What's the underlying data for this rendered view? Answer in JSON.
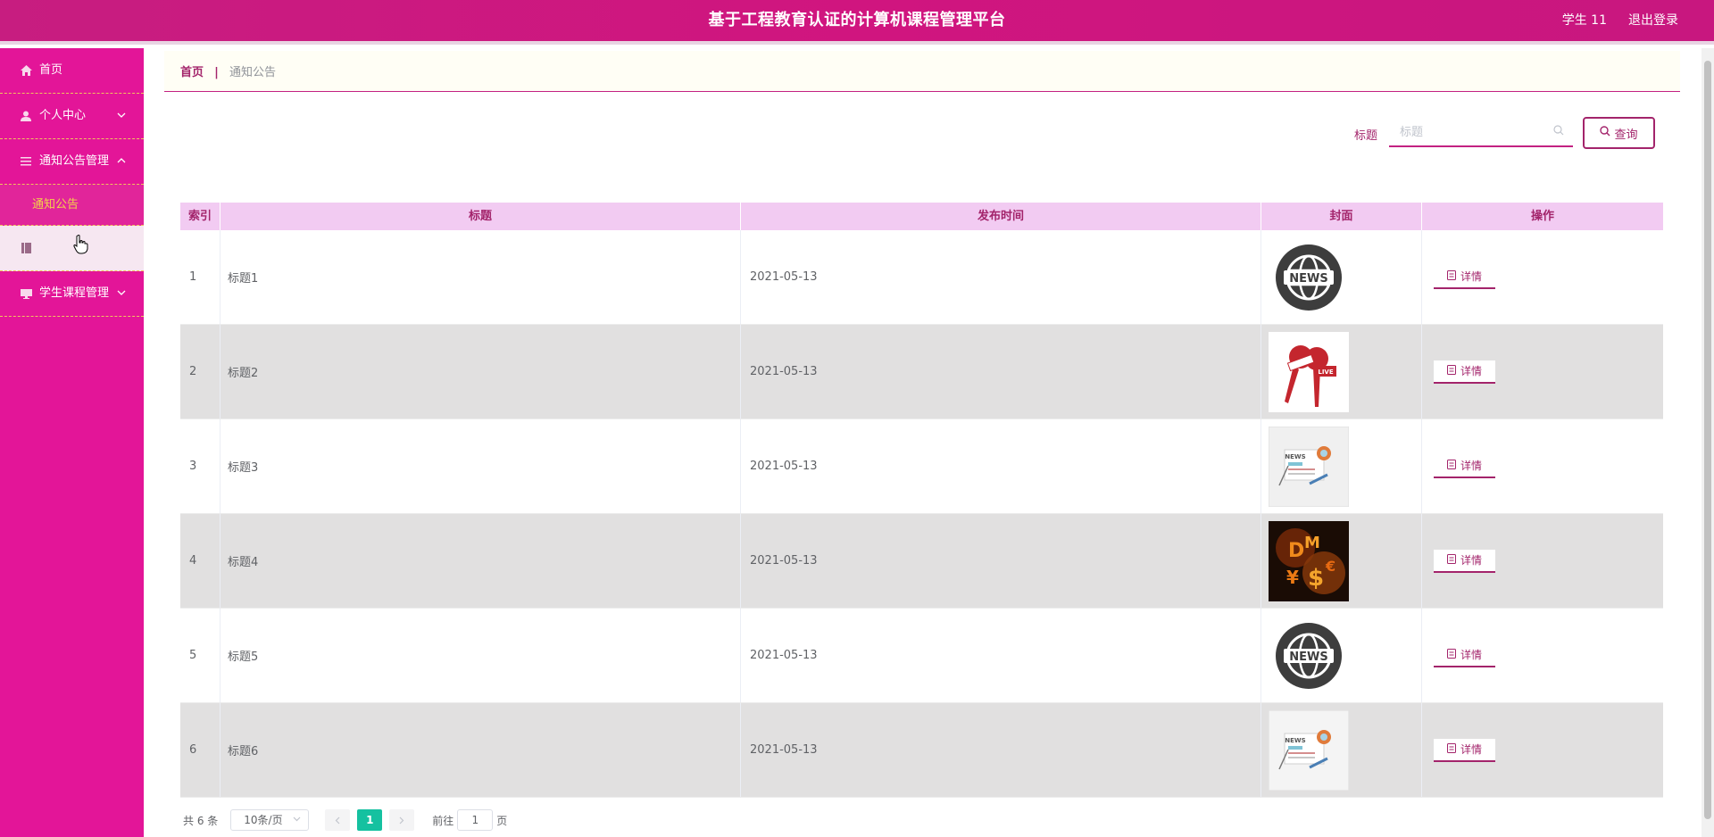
{
  "header": {
    "title": "基于工程教育认证的计算机课程管理平台",
    "user": "学生 11",
    "logout": "退出登录"
  },
  "sidebar": {
    "items": [
      {
        "label": "首页",
        "icon": "home-icon"
      },
      {
        "label": "个人中心",
        "icon": "user-icon"
      },
      {
        "label": "通知公告管理",
        "icon": "menu-icon"
      },
      {
        "label": "",
        "icon": "book-icon"
      },
      {
        "label": "学生课程管理",
        "icon": "monitor-icon"
      }
    ],
    "sub_active": "通知公告"
  },
  "breadcrumb": {
    "home": "首页",
    "sep": "|",
    "current": "通知公告"
  },
  "search": {
    "label": "标题",
    "placeholder": "标题",
    "button": "查询"
  },
  "table": {
    "headers": [
      "索引",
      "标题",
      "发布时间",
      "封面",
      "操作"
    ],
    "rows": [
      {
        "idx": "1",
        "title": "标题1",
        "date": "2021-05-13",
        "cover": "news-globe",
        "op": "详情"
      },
      {
        "idx": "2",
        "title": "标题2",
        "date": "2021-05-13",
        "cover": "live-mic",
        "op": "详情"
      },
      {
        "idx": "3",
        "title": "标题3",
        "date": "2021-05-13",
        "cover": "newspaper",
        "op": "详情"
      },
      {
        "idx": "4",
        "title": "标题4",
        "date": "2021-05-13",
        "cover": "money-fire",
        "op": "详情"
      },
      {
        "idx": "5",
        "title": "标题5",
        "date": "2021-05-13",
        "cover": "news-globe",
        "op": "详情"
      },
      {
        "idx": "6",
        "title": "标题6",
        "date": "2021-05-13",
        "cover": "newspaper",
        "op": "详情"
      }
    ]
  },
  "pager": {
    "total": "共 6 条",
    "size": "10条/页",
    "page": "1",
    "goto": "前往",
    "goto_value": "1",
    "unit": "页"
  },
  "colors": {
    "topbar": "#c71d80",
    "sidebar": "#e31598",
    "accent": "#a3246b",
    "active_page": "#15c1a0",
    "header_row": "#f2cbf2"
  }
}
